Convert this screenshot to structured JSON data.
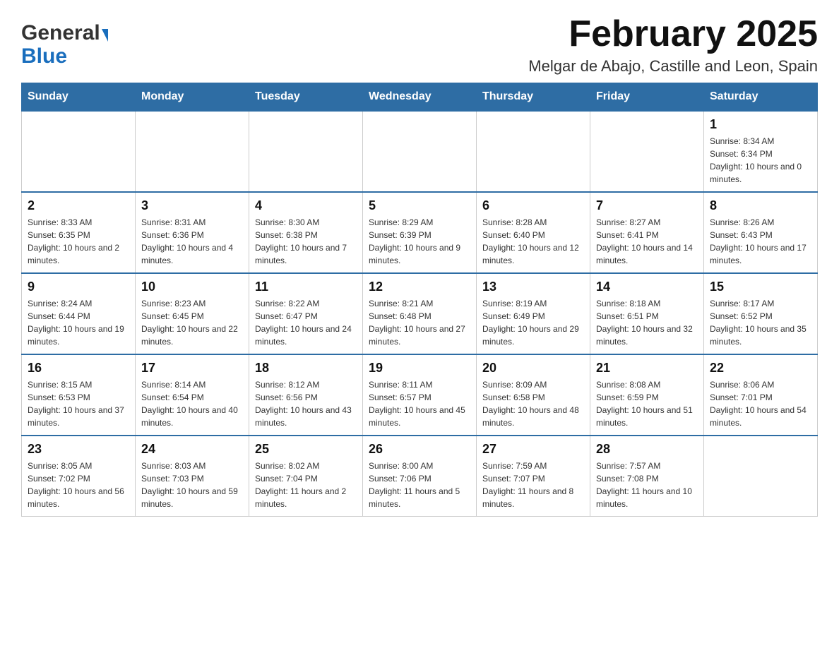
{
  "header": {
    "logo_general": "General",
    "logo_blue": "Blue",
    "month_title": "February 2025",
    "subtitle": "Melgar de Abajo, Castille and Leon, Spain"
  },
  "days_of_week": [
    "Sunday",
    "Monday",
    "Tuesday",
    "Wednesday",
    "Thursday",
    "Friday",
    "Saturday"
  ],
  "weeks": [
    [
      {
        "day": "",
        "sunrise": "",
        "sunset": "",
        "daylight": "",
        "empty": true
      },
      {
        "day": "",
        "sunrise": "",
        "sunset": "",
        "daylight": "",
        "empty": true
      },
      {
        "day": "",
        "sunrise": "",
        "sunset": "",
        "daylight": "",
        "empty": true
      },
      {
        "day": "",
        "sunrise": "",
        "sunset": "",
        "daylight": "",
        "empty": true
      },
      {
        "day": "",
        "sunrise": "",
        "sunset": "",
        "daylight": "",
        "empty": true
      },
      {
        "day": "",
        "sunrise": "",
        "sunset": "",
        "daylight": "",
        "empty": true
      },
      {
        "day": "1",
        "sunrise": "Sunrise: 8:34 AM",
        "sunset": "Sunset: 6:34 PM",
        "daylight": "Daylight: 10 hours and 0 minutes.",
        "empty": false
      }
    ],
    [
      {
        "day": "2",
        "sunrise": "Sunrise: 8:33 AM",
        "sunset": "Sunset: 6:35 PM",
        "daylight": "Daylight: 10 hours and 2 minutes.",
        "empty": false
      },
      {
        "day": "3",
        "sunrise": "Sunrise: 8:31 AM",
        "sunset": "Sunset: 6:36 PM",
        "daylight": "Daylight: 10 hours and 4 minutes.",
        "empty": false
      },
      {
        "day": "4",
        "sunrise": "Sunrise: 8:30 AM",
        "sunset": "Sunset: 6:38 PM",
        "daylight": "Daylight: 10 hours and 7 minutes.",
        "empty": false
      },
      {
        "day": "5",
        "sunrise": "Sunrise: 8:29 AM",
        "sunset": "Sunset: 6:39 PM",
        "daylight": "Daylight: 10 hours and 9 minutes.",
        "empty": false
      },
      {
        "day": "6",
        "sunrise": "Sunrise: 8:28 AM",
        "sunset": "Sunset: 6:40 PM",
        "daylight": "Daylight: 10 hours and 12 minutes.",
        "empty": false
      },
      {
        "day": "7",
        "sunrise": "Sunrise: 8:27 AM",
        "sunset": "Sunset: 6:41 PM",
        "daylight": "Daylight: 10 hours and 14 minutes.",
        "empty": false
      },
      {
        "day": "8",
        "sunrise": "Sunrise: 8:26 AM",
        "sunset": "Sunset: 6:43 PM",
        "daylight": "Daylight: 10 hours and 17 minutes.",
        "empty": false
      }
    ],
    [
      {
        "day": "9",
        "sunrise": "Sunrise: 8:24 AM",
        "sunset": "Sunset: 6:44 PM",
        "daylight": "Daylight: 10 hours and 19 minutes.",
        "empty": false
      },
      {
        "day": "10",
        "sunrise": "Sunrise: 8:23 AM",
        "sunset": "Sunset: 6:45 PM",
        "daylight": "Daylight: 10 hours and 22 minutes.",
        "empty": false
      },
      {
        "day": "11",
        "sunrise": "Sunrise: 8:22 AM",
        "sunset": "Sunset: 6:47 PM",
        "daylight": "Daylight: 10 hours and 24 minutes.",
        "empty": false
      },
      {
        "day": "12",
        "sunrise": "Sunrise: 8:21 AM",
        "sunset": "Sunset: 6:48 PM",
        "daylight": "Daylight: 10 hours and 27 minutes.",
        "empty": false
      },
      {
        "day": "13",
        "sunrise": "Sunrise: 8:19 AM",
        "sunset": "Sunset: 6:49 PM",
        "daylight": "Daylight: 10 hours and 29 minutes.",
        "empty": false
      },
      {
        "day": "14",
        "sunrise": "Sunrise: 8:18 AM",
        "sunset": "Sunset: 6:51 PM",
        "daylight": "Daylight: 10 hours and 32 minutes.",
        "empty": false
      },
      {
        "day": "15",
        "sunrise": "Sunrise: 8:17 AM",
        "sunset": "Sunset: 6:52 PM",
        "daylight": "Daylight: 10 hours and 35 minutes.",
        "empty": false
      }
    ],
    [
      {
        "day": "16",
        "sunrise": "Sunrise: 8:15 AM",
        "sunset": "Sunset: 6:53 PM",
        "daylight": "Daylight: 10 hours and 37 minutes.",
        "empty": false
      },
      {
        "day": "17",
        "sunrise": "Sunrise: 8:14 AM",
        "sunset": "Sunset: 6:54 PM",
        "daylight": "Daylight: 10 hours and 40 minutes.",
        "empty": false
      },
      {
        "day": "18",
        "sunrise": "Sunrise: 8:12 AM",
        "sunset": "Sunset: 6:56 PM",
        "daylight": "Daylight: 10 hours and 43 minutes.",
        "empty": false
      },
      {
        "day": "19",
        "sunrise": "Sunrise: 8:11 AM",
        "sunset": "Sunset: 6:57 PM",
        "daylight": "Daylight: 10 hours and 45 minutes.",
        "empty": false
      },
      {
        "day": "20",
        "sunrise": "Sunrise: 8:09 AM",
        "sunset": "Sunset: 6:58 PM",
        "daylight": "Daylight: 10 hours and 48 minutes.",
        "empty": false
      },
      {
        "day": "21",
        "sunrise": "Sunrise: 8:08 AM",
        "sunset": "Sunset: 6:59 PM",
        "daylight": "Daylight: 10 hours and 51 minutes.",
        "empty": false
      },
      {
        "day": "22",
        "sunrise": "Sunrise: 8:06 AM",
        "sunset": "Sunset: 7:01 PM",
        "daylight": "Daylight: 10 hours and 54 minutes.",
        "empty": false
      }
    ],
    [
      {
        "day": "23",
        "sunrise": "Sunrise: 8:05 AM",
        "sunset": "Sunset: 7:02 PM",
        "daylight": "Daylight: 10 hours and 56 minutes.",
        "empty": false
      },
      {
        "day": "24",
        "sunrise": "Sunrise: 8:03 AM",
        "sunset": "Sunset: 7:03 PM",
        "daylight": "Daylight: 10 hours and 59 minutes.",
        "empty": false
      },
      {
        "day": "25",
        "sunrise": "Sunrise: 8:02 AM",
        "sunset": "Sunset: 7:04 PM",
        "daylight": "Daylight: 11 hours and 2 minutes.",
        "empty": false
      },
      {
        "day": "26",
        "sunrise": "Sunrise: 8:00 AM",
        "sunset": "Sunset: 7:06 PM",
        "daylight": "Daylight: 11 hours and 5 minutes.",
        "empty": false
      },
      {
        "day": "27",
        "sunrise": "Sunrise: 7:59 AM",
        "sunset": "Sunset: 7:07 PM",
        "daylight": "Daylight: 11 hours and 8 minutes.",
        "empty": false
      },
      {
        "day": "28",
        "sunrise": "Sunrise: 7:57 AM",
        "sunset": "Sunset: 7:08 PM",
        "daylight": "Daylight: 11 hours and 10 minutes.",
        "empty": false
      },
      {
        "day": "",
        "sunrise": "",
        "sunset": "",
        "daylight": "",
        "empty": true
      }
    ]
  ]
}
